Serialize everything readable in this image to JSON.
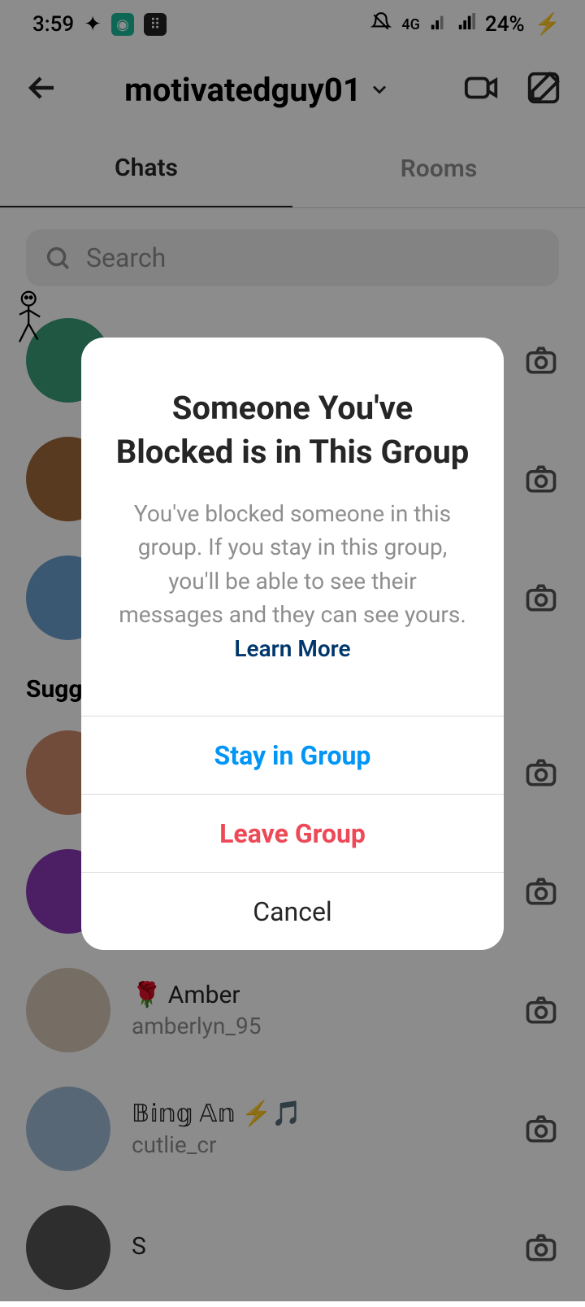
{
  "status": {
    "time": "3:59",
    "battery": "24%",
    "net": "4G"
  },
  "header": {
    "username": "motivatedguy01"
  },
  "tabs": {
    "chats": "Chats",
    "rooms": "Rooms"
  },
  "search": {
    "placeholder": "Search"
  },
  "section": {
    "suggested": "Suggested"
  },
  "chats": [
    {
      "name": "",
      "sub": ""
    },
    {
      "name": "",
      "sub": ""
    },
    {
      "name": "",
      "sub": ""
    }
  ],
  "suggested": [
    {
      "name": "",
      "sub": ""
    },
    {
      "name": "",
      "sub": ""
    },
    {
      "name": "🌹 Amber",
      "sub": "amberlyn_95"
    },
    {
      "name": "𝔹𝕚𝕟𝕘 𝔸𝕟 ⚡🎵",
      "sub": "cutlie_cr"
    },
    {
      "name": "S",
      "sub": ""
    }
  ],
  "dialog": {
    "title": "Someone You've Blocked is in This Group",
    "desc": "You've blocked someone in this group. If you stay in this group, you'll be able to see their messages and they can see yours. ",
    "learn_more": "Learn More",
    "stay": "Stay in Group",
    "leave": "Leave Group",
    "cancel": "Cancel"
  },
  "avatar_colors": [
    "#3a9f7a",
    "#9f6b3a",
    "#6ba0cf",
    "#cf8a6b",
    "#8a3ab9",
    "#d7c9b8",
    "#a0bcd7",
    "#555"
  ]
}
